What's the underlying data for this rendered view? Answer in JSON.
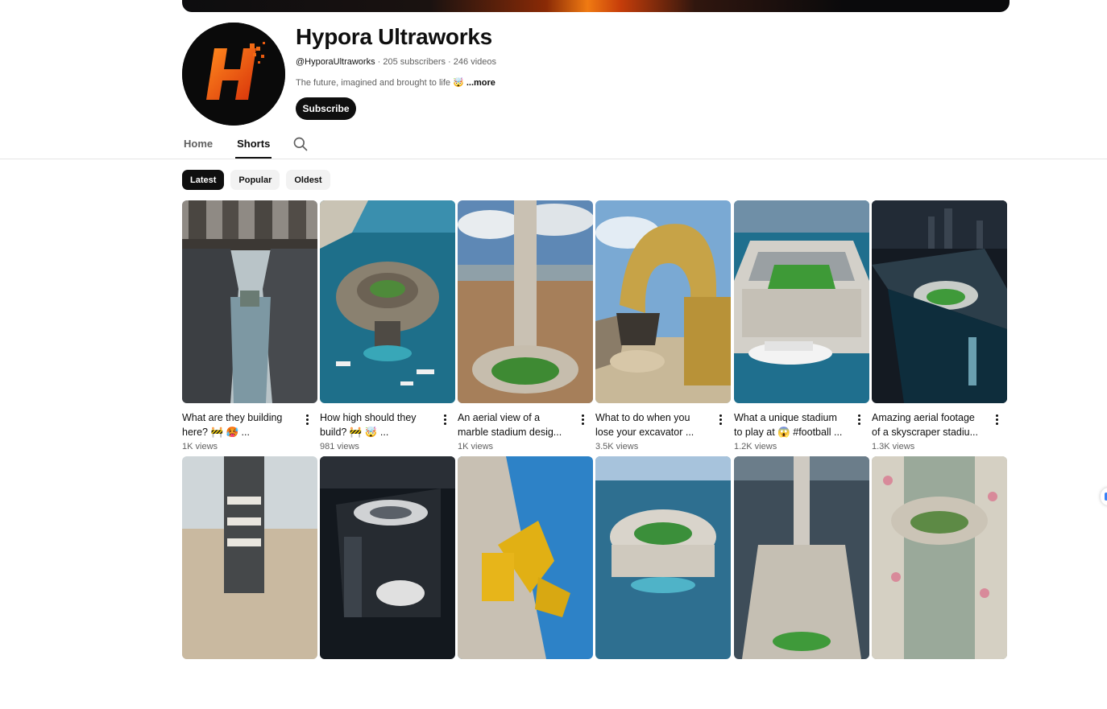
{
  "channel": {
    "name": "Hypora Ultraworks",
    "handle": "@HyporaUltraworks",
    "stats": " · 205 subscribers · 246 videos",
    "description": "The future, imagined and brought to life 🤯 ",
    "more_label": "...more",
    "subscribe_label": "Subscribe",
    "avatar_letter": "H"
  },
  "tabs": [
    {
      "label": "Home",
      "active": false
    },
    {
      "label": "Shorts",
      "active": true
    }
  ],
  "search_icon": "search-icon",
  "chips": [
    {
      "label": "Latest",
      "active": true
    },
    {
      "label": "Popular",
      "active": false
    },
    {
      "label": "Oldest",
      "active": false
    }
  ],
  "shorts": [
    {
      "title": "What are they building here? 🚧 🥵 ...",
      "views": "1K views"
    },
    {
      "title": "How high should they build? 🚧 🤯 ...",
      "views": "981 views"
    },
    {
      "title": "An aerial view of a marble stadium desig...",
      "views": "1K views"
    },
    {
      "title": "What to do when you lose your excavator ...",
      "views": "3.5K views"
    },
    {
      "title": "What a unique stadium to play at 😱 #football ...",
      "views": "1.2K views"
    },
    {
      "title": "Amazing aerial footage of a skyscraper stadiu...",
      "views": "1.3K views"
    },
    {
      "title": "",
      "views": ""
    },
    {
      "title": "",
      "views": ""
    },
    {
      "title": "",
      "views": ""
    },
    {
      "title": "",
      "views": ""
    },
    {
      "title": "",
      "views": ""
    },
    {
      "title": "",
      "views": ""
    }
  ],
  "colors": {
    "accent_orange": "#f05a12",
    "text_primary": "#0f0f0f",
    "text_secondary": "#606060"
  }
}
